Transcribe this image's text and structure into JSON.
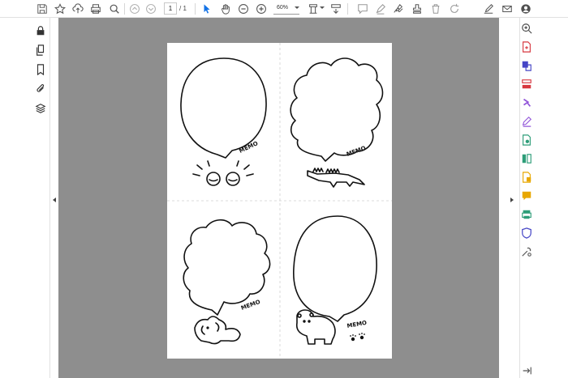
{
  "toolbar": {
    "page_current": "1",
    "page_separator": "/",
    "page_total": "1",
    "zoom_level": "60%",
    "icons": [
      "save-icon",
      "star-icon",
      "upload-icon",
      "print-icon",
      "search-icon",
      "page-up-icon",
      "page-down-icon",
      "cursor-icon",
      "hand-icon",
      "zoom-out-icon",
      "zoom-in-icon",
      "fit-page-icon",
      "scroll-mode-icon",
      "comment-icon",
      "highlight-icon",
      "sign-icon",
      "stamp-icon",
      "delete-icon",
      "rotate-icon",
      "fill-sign-icon",
      "mail-icon",
      "account-icon"
    ]
  },
  "left_panel": {
    "icons": [
      "lock-icon",
      "pages-icon",
      "bookmark-icon",
      "attachment-icon",
      "layers-icon"
    ]
  },
  "right_panel": {
    "icons": [
      "search-zoom-icon",
      "export-pdf-icon",
      "create-pdf-icon",
      "organize-pages-icon",
      "share-icon",
      "edit-pdf-icon",
      "scan-icon",
      "compress-icon",
      "convert-icon",
      "comment-tool-icon",
      "print-production-icon",
      "protect-icon",
      "more-tools-icon"
    ]
  },
  "document": {
    "memo_cards": [
      {
        "label": "MEMO",
        "character": "sleeping-eyes"
      },
      {
        "label": "MEMO",
        "character": "crocodile"
      },
      {
        "label": "MEMO",
        "character": "dog"
      },
      {
        "label": "MEMO",
        "character": "bear"
      }
    ]
  },
  "colors": {
    "accent": "#1473e6",
    "canvas": "#8e8e8e",
    "page": "#ffffff",
    "tool_red": "#d7373f",
    "tool_purple": "#9256d9",
    "tool_green": "#2d9d78",
    "tool_yellow": "#e8a700",
    "tool_blue": "#4646c6"
  }
}
